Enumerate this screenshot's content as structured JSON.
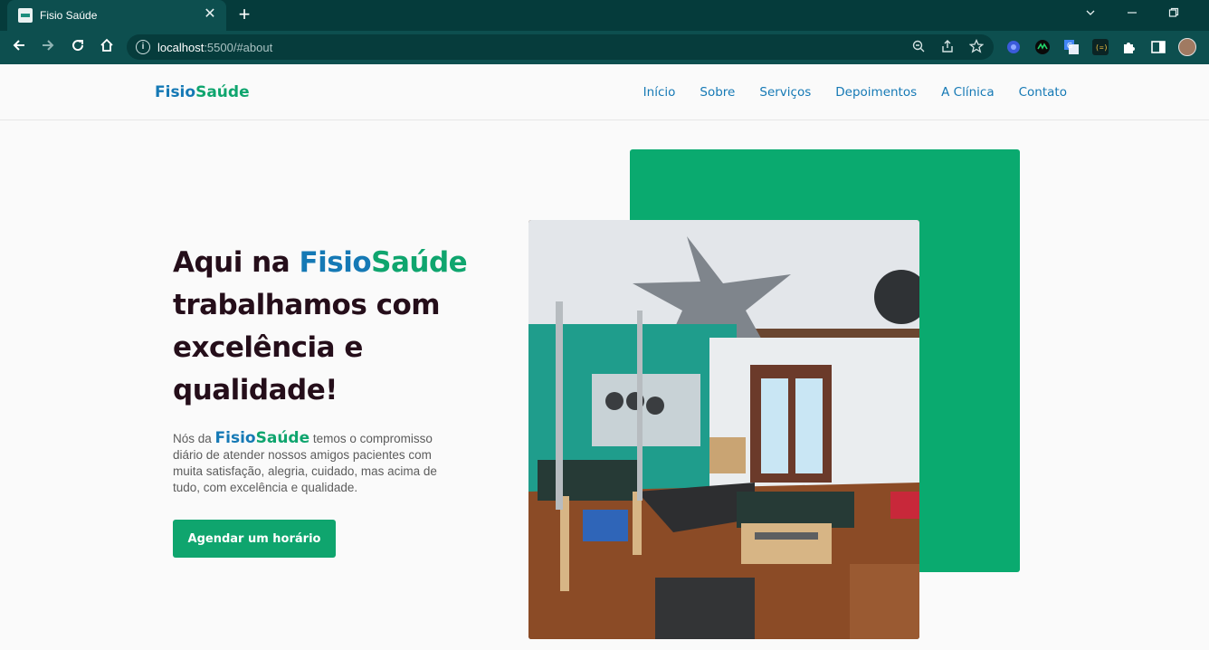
{
  "browser": {
    "tab_title": "Fisio Saúde",
    "tab_close_icon": "close-icon",
    "new_tab_icon": "plus-icon",
    "url_host": "localhost",
    "url_path": ":5500/#about",
    "window_controls": [
      "chevron-down-icon",
      "minimize-icon",
      "restore-icon"
    ],
    "toolbar_icons": [
      "back-arrow-icon",
      "forward-arrow-icon",
      "reload-icon",
      "home-icon"
    ],
    "omnibox_icons": [
      "info-icon",
      "zoom-out-icon",
      "share-icon",
      "star-icon"
    ],
    "extension_icons": [
      "extension-blue-icon",
      "extension-green-icon",
      "translate-icon",
      "extension-bracket-icon",
      "puzzle-icon",
      "side-panel-icon",
      "profile-avatar"
    ]
  },
  "site": {
    "logo": {
      "part1": "Fisio",
      "part2": "Saúde"
    },
    "nav": [
      "Início",
      "Sobre",
      "Serviços",
      "Depoimentos",
      "A Clínica",
      "Contato"
    ],
    "hero": {
      "title_before": "Aqui na ",
      "title_brand1": "Fisio",
      "title_brand2": "Saúde",
      "title_after": " trabalhamos com excelência e qualidade!",
      "text_before": "Nós da ",
      "text_brand1": "Fisio",
      "text_brand2": "Saúde",
      "text_after": " temos o compromisso diário de atender nossos amigos pacientes com muita satisfação, alegria, cuidado, mas acima de tudo, com excelência e qualidade.",
      "cta_label": "Agendar um horário"
    }
  },
  "colors": {
    "brand_blue": "#1579b5",
    "brand_green": "#0fa56e",
    "heading": "#250e1a",
    "chrome_dark": "#053b3b",
    "chrome_toolbar": "#0d4f4f"
  }
}
